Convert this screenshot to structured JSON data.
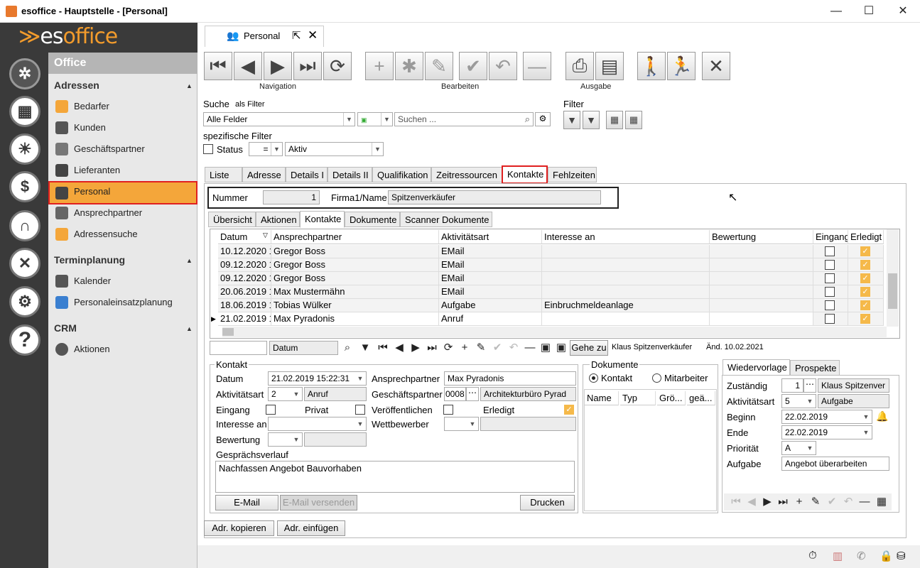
{
  "window": {
    "title": "esoffice - Hauptstelle - [Personal]",
    "min": "—",
    "max": "☐",
    "close": "✕"
  },
  "logo": {
    "pre": "≫",
    "es": "es",
    "office": "office"
  },
  "iconbar": [
    {
      "icon": "helm-icon"
    },
    {
      "icon": "calculator-icon"
    },
    {
      "icon": "alarm-icon"
    },
    {
      "icon": "money-icon"
    },
    {
      "icon": "headset-icon"
    },
    {
      "icon": "tools-icon"
    },
    {
      "icon": "gears-icon"
    },
    {
      "icon": "help-icon"
    }
  ],
  "nav": {
    "office": "Office",
    "adressen": "Adressen",
    "items": [
      "Bedarfer",
      "Kunden",
      "Geschäftspartner",
      "Lieferanten",
      "Personal",
      "Ansprechpartner",
      "Adressensuche"
    ],
    "terminplanung": "Terminplanung",
    "termin_items": [
      "Kalender",
      "Personaleinsatzplanung"
    ],
    "crm": "CRM",
    "crm_items": [
      "Aktionen"
    ]
  },
  "doc_tab": {
    "label": "Personal",
    "popout": "⇱",
    "close": "✕"
  },
  "toolbar": {
    "navigation": "Navigation",
    "bearbeiten": "Bearbeiten",
    "ausgabe": "Ausgabe"
  },
  "search": {
    "label": "Suche",
    "als_filter": "als Filter",
    "field": "Alle Felder",
    "placeholder": "Suchen ...",
    "filter": "Filter"
  },
  "spec": {
    "label": "spezifische Filter",
    "status": "Status",
    "op": "=",
    "value": "Aktiv"
  },
  "tabs": [
    "Liste",
    "Adresse",
    "Details I",
    "Details II",
    "Qualifikation",
    "Zeitressourcen",
    "Kontakte",
    "Fehlzeiten"
  ],
  "record": {
    "nummer_label": "Nummer",
    "nummer": "1",
    "firma_label": "Firma1/Name",
    "firma": "Spitzenverkäufer"
  },
  "subtabs": [
    "Übersicht",
    "Aktionen",
    "Kontakte",
    "Dokumente",
    "Scanner Dokumente"
  ],
  "grid": {
    "headers": [
      "Datum",
      "Ansprechpartner",
      "Aktivitätsart",
      "Interesse an",
      "Bewertung",
      "Eingang",
      "Erledigt"
    ],
    "rows": [
      [
        "10.12.2020 1",
        "Gregor Boss",
        "EMail",
        "",
        ""
      ],
      [
        "09.12.2020 1",
        "Gregor Boss",
        "EMail",
        "",
        ""
      ],
      [
        "09.12.2020 1",
        "Gregor Boss",
        "EMail",
        "",
        ""
      ],
      [
        "20.06.2019 1",
        "Max Mustermähn",
        "EMail",
        "",
        ""
      ],
      [
        "18.06.2019 1",
        "Tobias Wülker",
        "Aufgabe",
        "Einbruchmeldeanlage",
        ""
      ],
      [
        "21.02.2019 1",
        "Max Pyradonis",
        "Anruf",
        "",
        ""
      ]
    ],
    "footer_field": "Datum",
    "goto": "Gehe zu",
    "creator": "Klaus Spitzenverkäufer",
    "changed": "Änd. 10.02.2021"
  },
  "kontakt": {
    "legend": "Kontakt",
    "datum_label": "Datum",
    "datum": "21.02.2019 15:22:31",
    "ap_label": "Ansprechpartner",
    "ap": "Max Pyradonis",
    "akt_label": "Aktivitätsart",
    "akt_num": "2",
    "akt_text": "Anruf",
    "gp_label": "Geschäftspartner",
    "gp_num": "0008",
    "gp_text": "Architekturbüro Pyrad",
    "eingang": "Eingang",
    "privat": "Privat",
    "veroeff": "Veröffentlichen",
    "erledigt": "Erledigt",
    "interesse": "Interesse an",
    "wettbewerber": "Wettbewerber",
    "bewertung": "Bewertung",
    "verlauf_label": "Gesprächsverlauf",
    "verlauf": "Nachfassen Angebot Bauvorhaben",
    "email": "E-Mail",
    "email_send": "E-Mail versenden",
    "drucken": "Drucken"
  },
  "dokumente": {
    "legend": "Dokumente",
    "kontakt": "Kontakt",
    "mitarbeiter": "Mitarbeiter",
    "cols": [
      "Name",
      "Typ",
      "Grö...",
      "geä..."
    ]
  },
  "wv": {
    "tab1": "Wiedervorlage",
    "tab2": "Prospekte",
    "zustaendig_label": "Zuständig",
    "zustaendig_num": "1",
    "zustaendig": "Klaus Spitzenver",
    "akt_label": "Aktivitätsart",
    "akt_num": "5",
    "akt_text": "Aufgabe",
    "beginn_label": "Beginn",
    "beginn": "22.02.2019",
    "ende_label": "Ende",
    "ende": "22.02.2019",
    "prio_label": "Priorität",
    "prio": "A",
    "aufgabe_label": "Aufgabe",
    "aufgabe": "Angebot überarbeiten"
  },
  "bottom": {
    "kopieren": "Adr. kopieren",
    "einfuegen": "Adr. einfügen"
  },
  "colors": {
    "accent": "#f4a63a",
    "sidebar": "#3a3a3a",
    "highlight": "#e02020"
  }
}
